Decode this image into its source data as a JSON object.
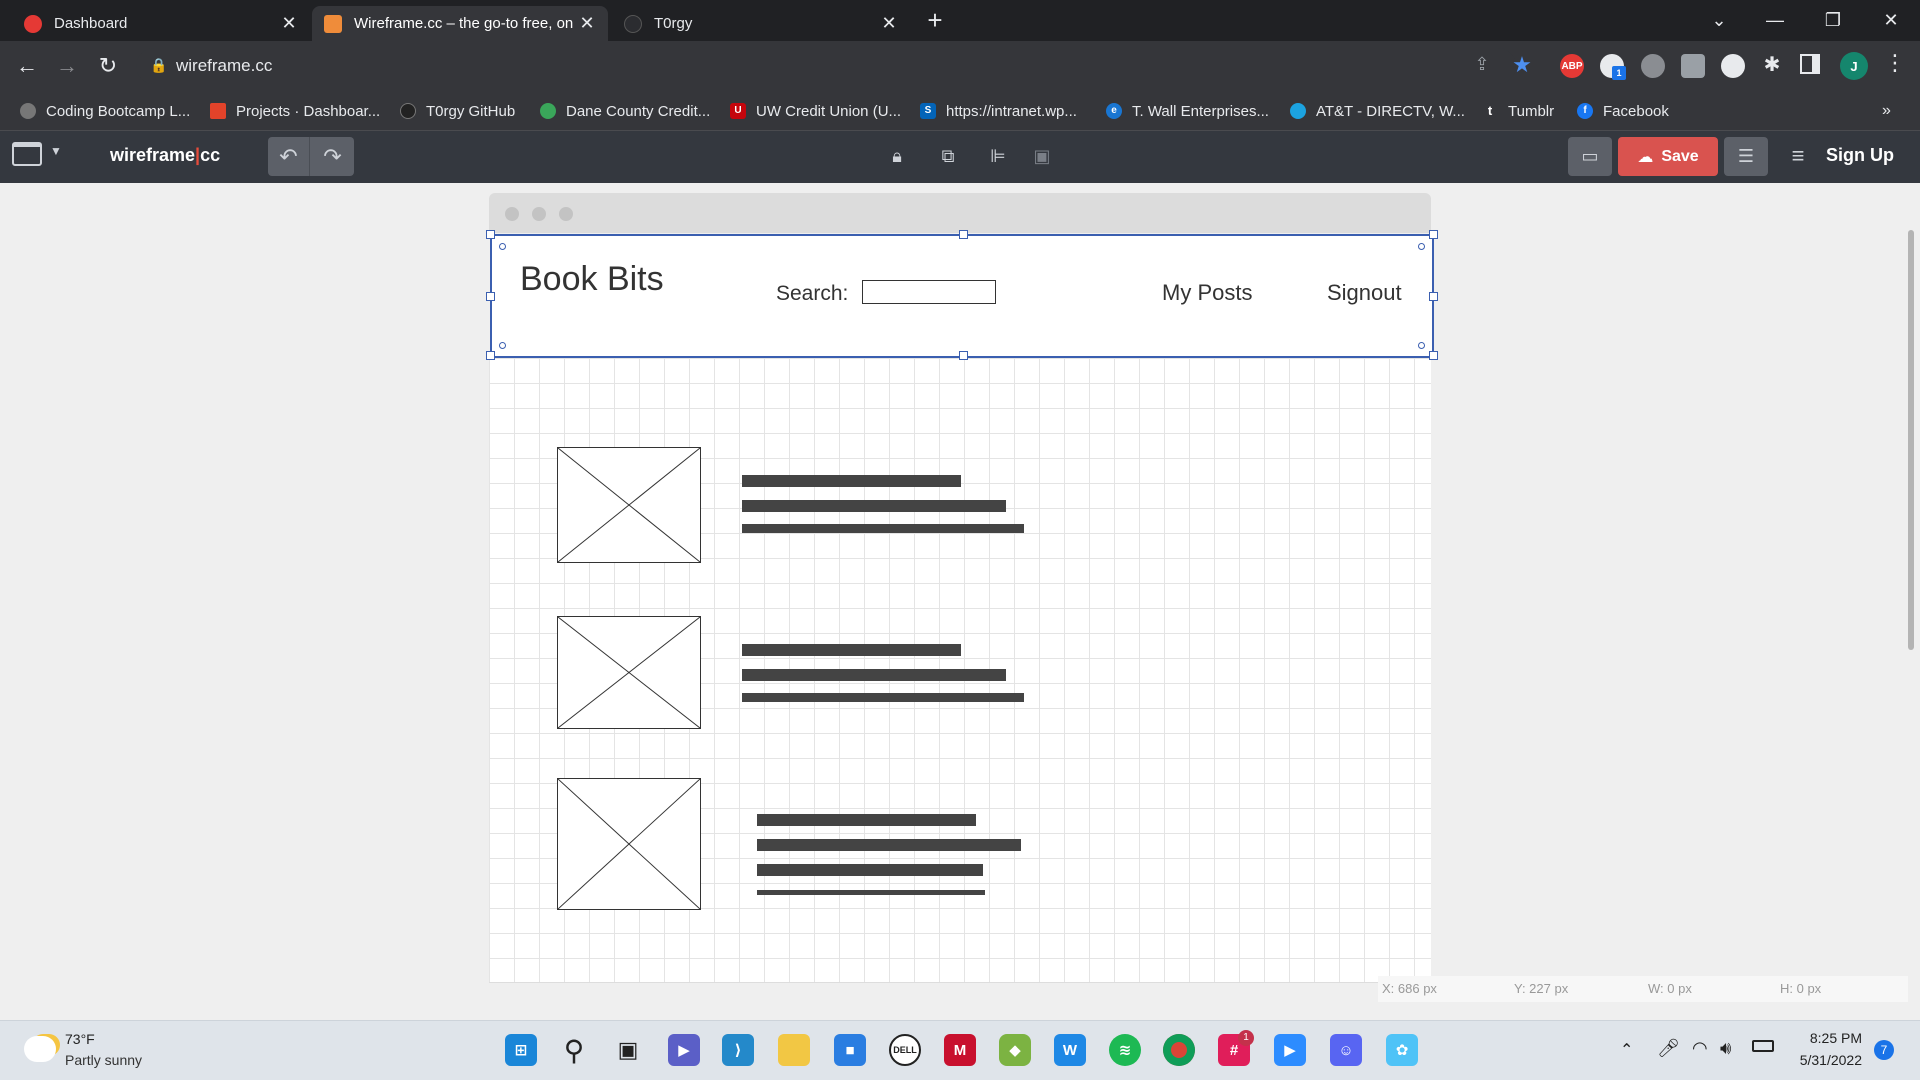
{
  "browser": {
    "tabs": [
      {
        "title": "Dashboard",
        "icon": "canvas-icon"
      },
      {
        "title": "Wireframe.cc – the go-to free, on",
        "icon": "wireframe-icon",
        "active": true
      },
      {
        "title": "T0rgy",
        "icon": "github-icon"
      }
    ],
    "url": "wireframe.cc",
    "profile_initial": "J",
    "extensions": [
      "share-icon",
      "star-icon",
      "adblock-icon",
      "extension-badge-icon",
      "extension-icon",
      "camera-icon",
      "extension-icon",
      "puzzle-icon",
      "sidepanel-icon"
    ],
    "ext_abp_label": "ABP",
    "ext_badge": "1",
    "bookmarks": [
      "Coding Bootcamp L...",
      "Projects · Dashboar...",
      "T0rgy GitHub",
      "Dane County Credit...",
      "UW Credit Union (U...",
      "https://intranet.wp...",
      "T. Wall Enterprises...",
      "AT&T - DIRECTV, W...",
      "Tumblr",
      "Facebook"
    ],
    "bookmarks_more": "»"
  },
  "app": {
    "logo_left": "wireframe",
    "logo_right": "cc",
    "save_label": "Save",
    "signup_label": "Sign Up"
  },
  "wireframe": {
    "title": "Book Bits",
    "search_label": "Search:",
    "nav": [
      "My Posts",
      "Signout"
    ]
  },
  "status": {
    "x": "X: 686 px",
    "y": "Y: 227 px",
    "w": "W: 0 px",
    "h": "H: 0 px"
  },
  "taskbar": {
    "weather_temp": "73°F",
    "weather_desc": "Partly sunny",
    "time": "8:25 PM",
    "date": "5/31/2022",
    "notification_count": "7",
    "slack_badge": "1"
  },
  "colors": {
    "selection": "#3b5fb0",
    "save_button": "#d9534f",
    "toolbar_bg": "#34383f"
  }
}
